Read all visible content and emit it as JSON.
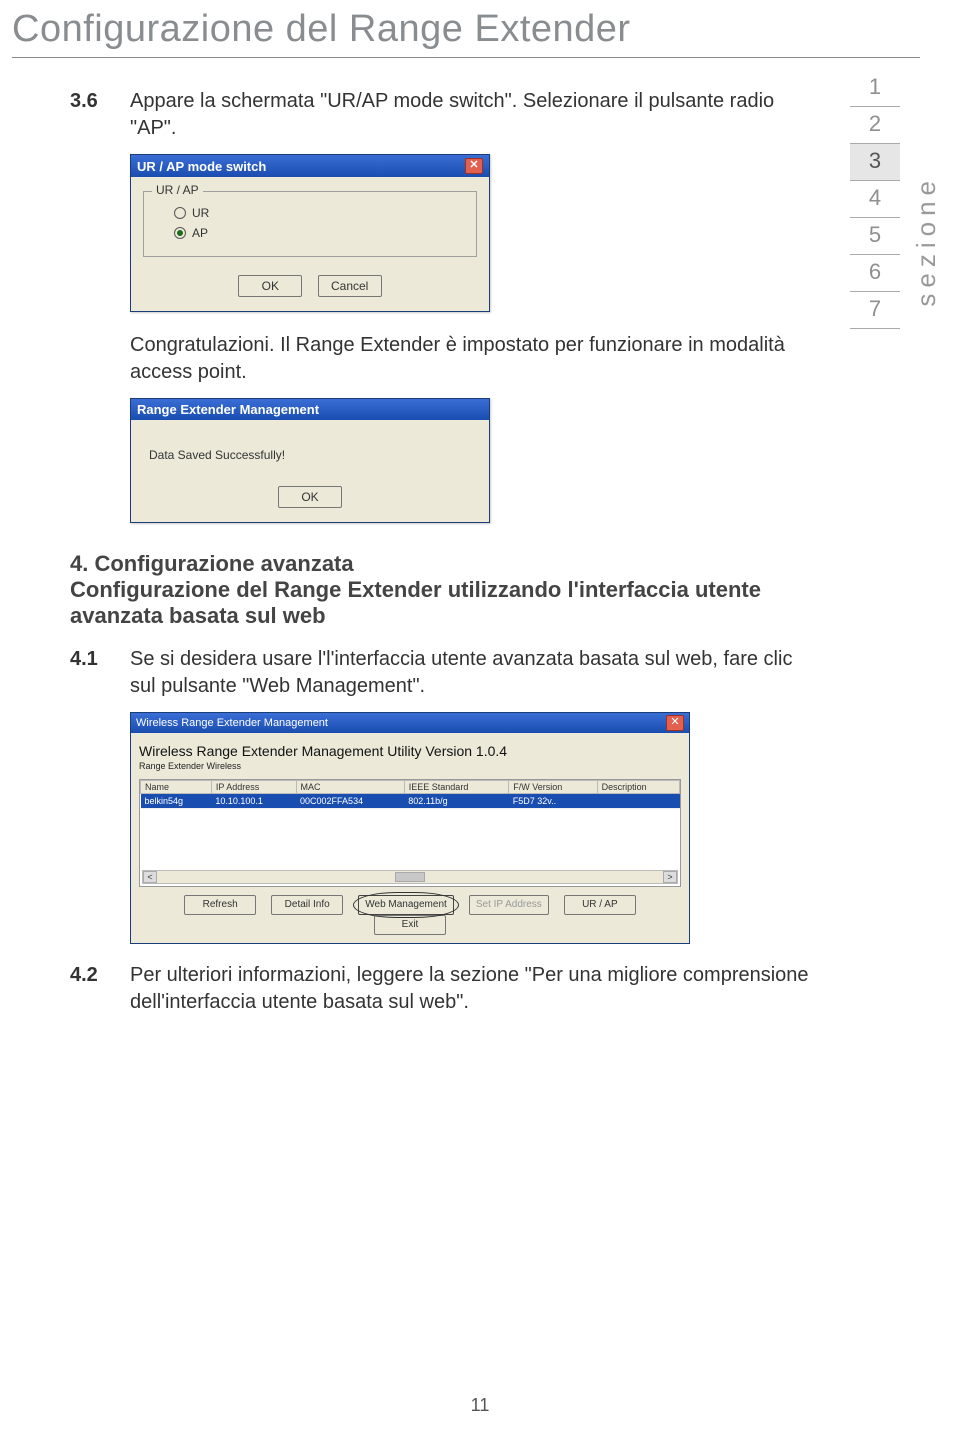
{
  "page_title": "Configurazione del Range Extender",
  "side_nav": [
    "1",
    "2",
    "3",
    "4",
    "5",
    "6",
    "7"
  ],
  "side_nav_active_index": 2,
  "side_label": "sezione",
  "step_36": {
    "num": "3.6",
    "text": "Appare la schermata \"UR/AP mode switch\". Selezionare il pulsante radio \"AP\"."
  },
  "dialog1": {
    "title": "UR / AP mode switch",
    "group_label": "UR / AP",
    "options": [
      {
        "label": "UR",
        "checked": false
      },
      {
        "label": "AP",
        "checked": true
      }
    ],
    "buttons": [
      "OK",
      "Cancel"
    ]
  },
  "congrats_text": "Congratulazioni. Il Range Extender è impostato per funzionare in modalità access point.",
  "dialog2": {
    "title": "Range Extender Management",
    "body": "Data Saved Successfully!",
    "button": "OK"
  },
  "section4": {
    "heading": "4. Configurazione avanzata",
    "sub": "Configurazione del Range Extender utilizzando l'interfaccia utente avanzata basata sul web"
  },
  "step_41": {
    "num": "4.1",
    "text": "Se si desidera usare l'l'interfaccia utente avanzata basata sul web, fare clic sul pulsante  \"Web Management\"."
  },
  "mgmt": {
    "win_title": "Wireless Range Extender Management",
    "version": "Wireless Range Extender Management Utility Version 1.0.4",
    "sublabel": "Range Extender Wireless",
    "columns": [
      "Name",
      "IP Address",
      "MAC",
      "IEEE Standard",
      "F/W Version",
      "Description"
    ],
    "row": [
      "belkin54g",
      "10.10.100.1",
      "00C002FFA534",
      "802.11b/g",
      "F5D7 32v..",
      ""
    ],
    "buttons": [
      {
        "label": "Refresh",
        "state": "normal"
      },
      {
        "label": "Detail Info",
        "state": "normal"
      },
      {
        "label": "Web Management",
        "state": "circled"
      },
      {
        "label": "Set IP Address",
        "state": "disabled"
      },
      {
        "label": "UR / AP",
        "state": "normal"
      },
      {
        "label": "Exit",
        "state": "normal"
      }
    ]
  },
  "step_42": {
    "num": "4.2",
    "text": "Per ulteriori informazioni, leggere la sezione \"Per una migliore comprensione dell'interfaccia utente basata sul web\"."
  },
  "page_number": "11"
}
